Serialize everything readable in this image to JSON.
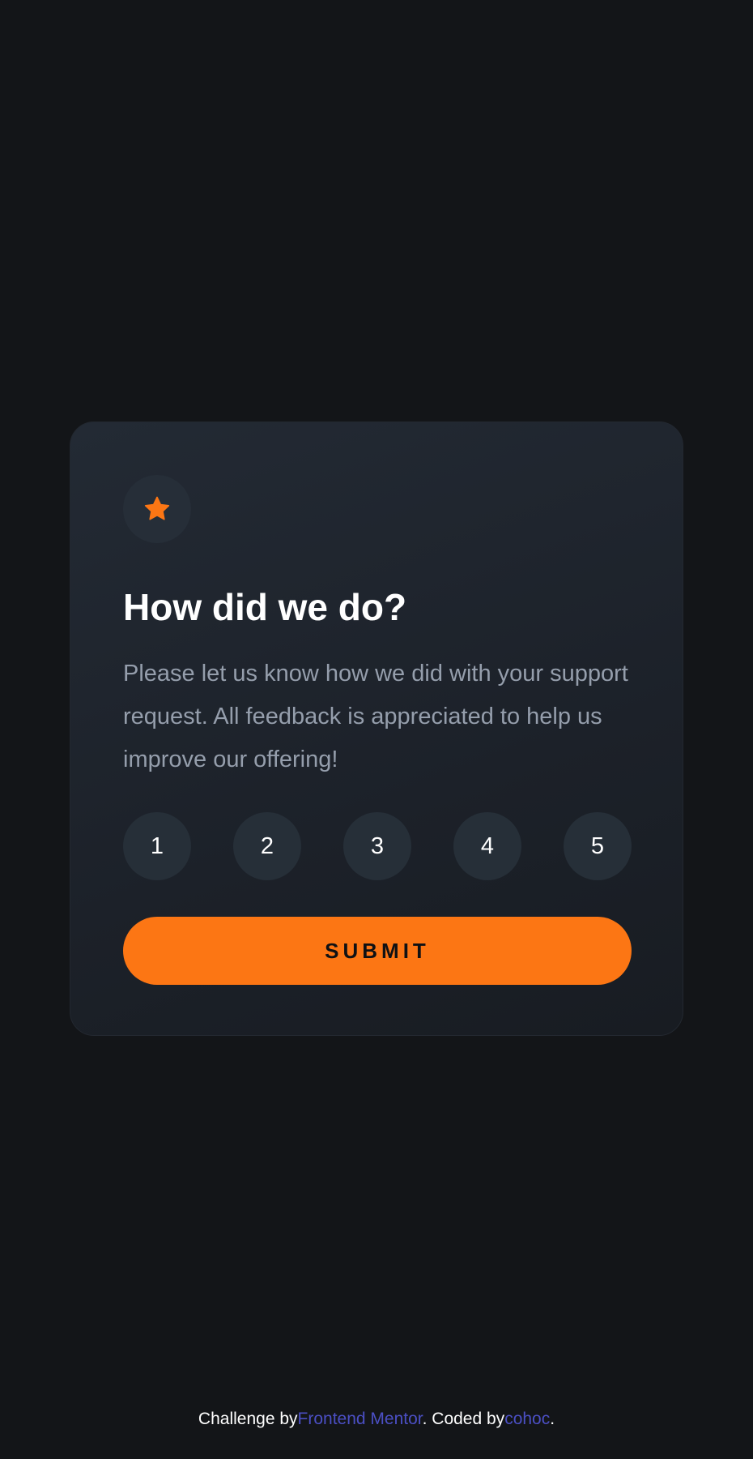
{
  "card": {
    "icon": "star-icon",
    "title": "How did we do?",
    "description": "Please let us know how we did with your support request. All feedback is appreciated to help us improve our offering!",
    "ratings": [
      "1",
      "2",
      "3",
      "4",
      "5"
    ],
    "submit_label": "SUBMIT"
  },
  "footer": {
    "challenge_prefix": "Challenge by",
    "challenge_link": "Frontend Mentor",
    "coded_prefix": ". Coded by",
    "coded_link": "cohoc",
    "suffix": "."
  },
  "colors": {
    "background": "#131518",
    "card": "#1f252d",
    "accent": "#fc7614",
    "text_muted": "#959eac",
    "link": "#4b4fc4"
  }
}
